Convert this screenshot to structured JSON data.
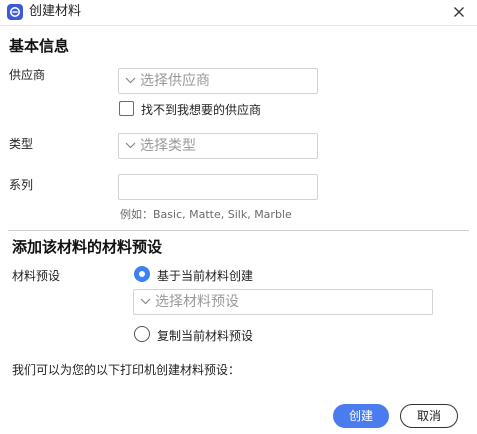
{
  "window": {
    "title": "创建材料",
    "accent_color": "#3b5bdb"
  },
  "basic_info": {
    "heading": "基本信息",
    "supplier": {
      "label": "供应商",
      "placeholder": "选择供应商",
      "not_found_checkbox": {
        "label": "找不到我想要的供应商",
        "checked": false
      }
    },
    "type": {
      "label": "类型",
      "placeholder": "选择类型"
    },
    "series": {
      "label": "系列",
      "value": "",
      "hint": "例如：Basic, Matte, Silk, Marble"
    }
  },
  "preset": {
    "heading": "添加该材料的材料预设",
    "label": "材料预设",
    "options": [
      {
        "label": "基于当前材料创建",
        "selected": true
      },
      {
        "label": "复制当前材料预设",
        "selected": false
      }
    ],
    "preset_placeholder": "选择材料预设",
    "printer_note": "我们可以为您的以下打印机创建材料预设："
  },
  "footer": {
    "create_label": "创建",
    "cancel_label": "取消",
    "primary_color": "#4a7cf0"
  },
  "icons": {
    "app": "material-icon",
    "close": "close-icon",
    "dropdown": "chevron-down-icon"
  }
}
